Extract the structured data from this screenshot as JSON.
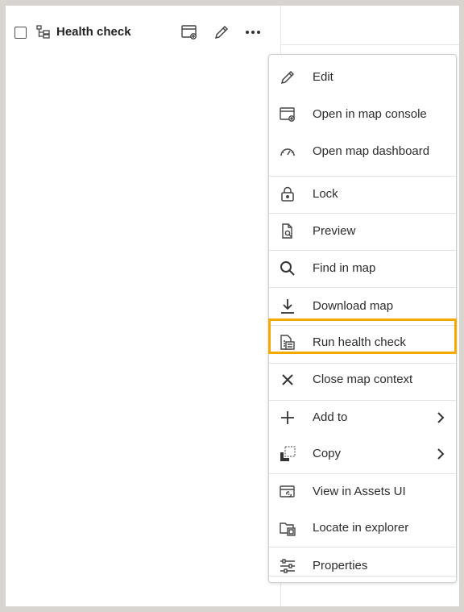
{
  "row": {
    "title": "Health check"
  },
  "menu": {
    "items": [
      {
        "label": "Edit",
        "icon": "pencil-icon"
      },
      {
        "label": "Open in map console",
        "icon": "map-console-icon"
      },
      {
        "label": "Open map dashboard",
        "icon": "gauge-icon"
      },
      {
        "label": "Lock",
        "icon": "lock-icon"
      },
      {
        "label": "Preview",
        "icon": "preview-icon"
      },
      {
        "label": "Find in map",
        "icon": "search-icon"
      },
      {
        "label": "Download map",
        "icon": "download-icon"
      },
      {
        "label": "Run health check",
        "icon": "health-check-icon"
      },
      {
        "label": "Close map context",
        "icon": "close-icon"
      },
      {
        "label": "Add to",
        "icon": "plus-icon",
        "submenu": true
      },
      {
        "label": "Copy",
        "icon": "copy-icon",
        "submenu": true
      },
      {
        "label": "View in Assets UI",
        "icon": "assets-icon"
      },
      {
        "label": "Locate in explorer",
        "icon": "folder-locate-icon"
      },
      {
        "label": "Properties",
        "icon": "sliders-icon"
      }
    ],
    "highlighted": "Run health check"
  },
  "colors": {
    "highlight": "#f2a900",
    "background": "#d8d5d0"
  }
}
